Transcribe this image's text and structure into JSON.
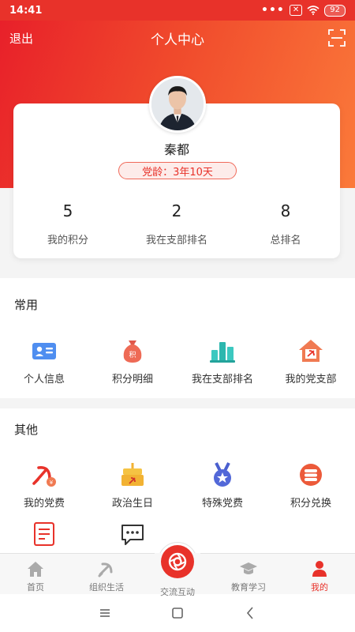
{
  "status_bar": {
    "time": "14:41",
    "dots": "•••",
    "box_icon": "✕",
    "battery": "92"
  },
  "header": {
    "back_label": "退出",
    "title": "个人中心"
  },
  "profile": {
    "name": "秦都",
    "tenure": "党龄：3年10天"
  },
  "stats": [
    {
      "value": "5",
      "label": "我的积分"
    },
    {
      "value": "2",
      "label": "我在支部排名"
    },
    {
      "value": "8",
      "label": "总排名"
    }
  ],
  "common": {
    "title": "常用",
    "items": [
      {
        "label": "个人信息",
        "icon": "id-card-icon"
      },
      {
        "label": "积分明细",
        "icon": "points-bag-icon"
      },
      {
        "label": "我在支部排名",
        "icon": "ranking-bars-icon"
      },
      {
        "label": "我的党支部",
        "icon": "party-branch-house-icon"
      }
    ]
  },
  "other": {
    "title": "其他",
    "items": [
      {
        "label": "我的党费",
        "icon": "party-fee-icon"
      },
      {
        "label": "政治生日",
        "icon": "political-birthday-cake-icon"
      },
      {
        "label": "特殊党费",
        "icon": "special-fee-medal-icon"
      },
      {
        "label": "积分兑换",
        "icon": "points-exchange-coins-icon"
      },
      {
        "label": "",
        "icon": "document-icon"
      },
      {
        "label": "",
        "icon": "message-icon"
      }
    ]
  },
  "tab_bar": {
    "tabs": [
      {
        "label": "首页",
        "icon": "home-icon"
      },
      {
        "label": "组织生活",
        "icon": "party-emblem-icon"
      },
      {
        "label": "交流互动",
        "icon": "camera-shutter-icon"
      },
      {
        "label": "教育学习",
        "icon": "graduation-cap-icon"
      },
      {
        "label": "我的",
        "icon": "user-icon"
      }
    ],
    "active": "我的"
  },
  "colors": {
    "primary": "#e8322a",
    "header_gradient_end": "#fb7a3a"
  }
}
